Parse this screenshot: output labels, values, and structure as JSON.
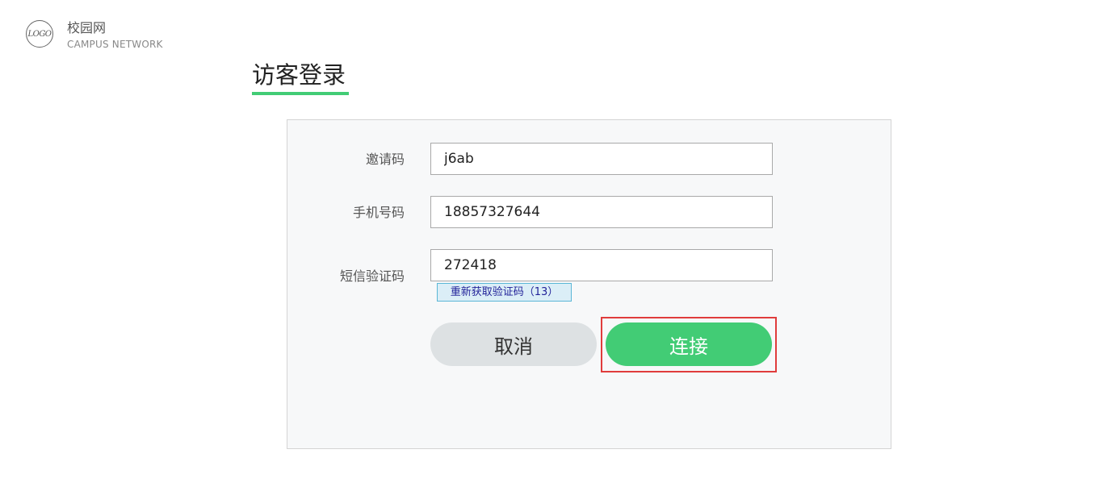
{
  "brand": {
    "logo_text": "LOGO",
    "name": "校园网",
    "subtitle": "CAMPUS NETWORK"
  },
  "page": {
    "title": "访客登录"
  },
  "form": {
    "invite_code": {
      "label": "邀请码",
      "value": "j6ab"
    },
    "phone": {
      "label": "手机号码",
      "value": "18857327644"
    },
    "sms_code": {
      "label": "短信验证码",
      "value": "272418"
    },
    "resend_label": "重新获取验证码（13）",
    "cancel_label": "取消",
    "connect_label": "连接"
  },
  "colors": {
    "accent": "#42cc75",
    "highlight": "#e03c3c",
    "panel_bg": "#f7f8f9"
  }
}
